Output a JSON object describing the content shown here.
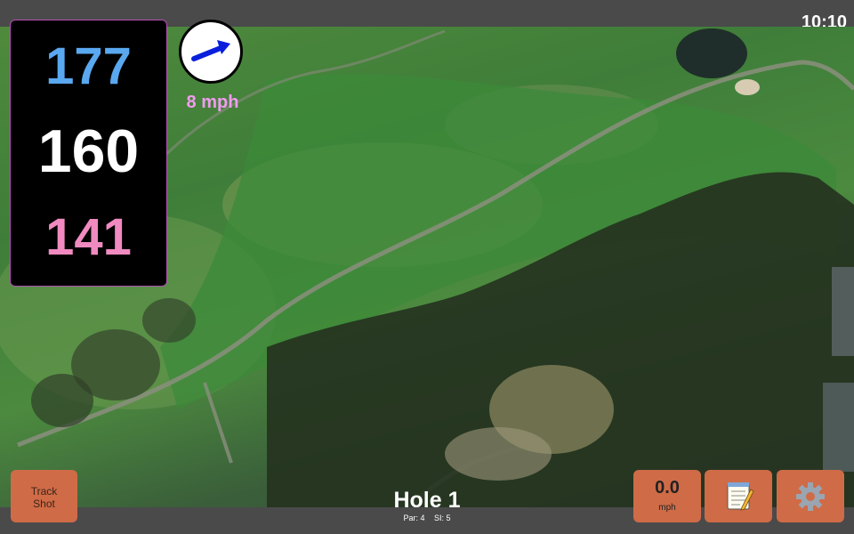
{
  "status": {
    "time": "10:10"
  },
  "distances": {
    "back": "177",
    "center": "160",
    "front": "141"
  },
  "wind": {
    "speed_label": "8 mph"
  },
  "buttons": {
    "track_shot_line1": "Track",
    "track_shot_line2": "Shot",
    "speed_value": "0.0",
    "speed_unit": "mph"
  },
  "hole": {
    "title": "Hole 1",
    "par": "Par: 4",
    "si": "SI: 5"
  },
  "colors": {
    "back_distance": "#5aa8f0",
    "center_distance": "#ffffff",
    "front_distance": "#f08ac0",
    "wind_label": "#f29bf0",
    "button": "#d06b47"
  },
  "icons": {
    "wind_arrow": "arrow-icon",
    "notes": "notepad-icon",
    "settings": "gear-icon"
  }
}
